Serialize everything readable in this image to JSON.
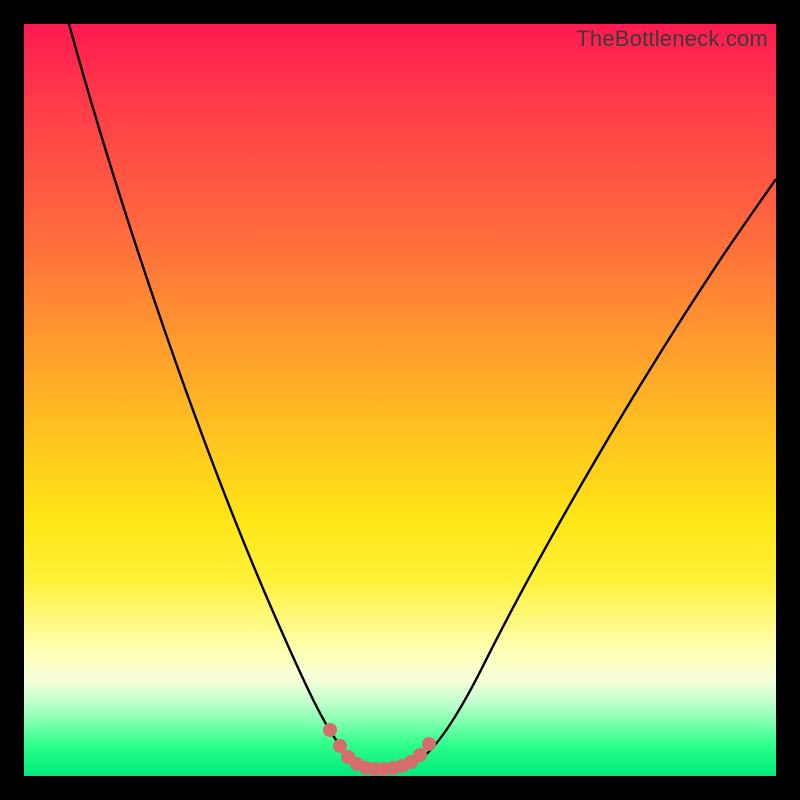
{
  "watermark": "TheBottleneck.com",
  "colors": {
    "frame": "#000000",
    "curve": "#000000",
    "dots": "#d66d6d"
  },
  "chart_data": {
    "type": "line",
    "title": "",
    "xlabel": "",
    "ylabel": "",
    "xlim": [
      0,
      100
    ],
    "ylim": [
      0,
      100
    ],
    "grid": false,
    "series": [
      {
        "name": "bottleneck-curve",
        "x": [
          6,
          10,
          15,
          20,
          25,
          30,
          35,
          38,
          40,
          42,
          44,
          46,
          48,
          50,
          52,
          54,
          58,
          65,
          75,
          85,
          95,
          100
        ],
        "y": [
          100,
          87,
          72,
          57,
          44,
          32,
          20,
          12,
          7,
          4,
          2,
          1,
          1,
          1,
          2,
          4,
          10,
          22,
          38,
          52,
          63,
          69
        ]
      }
    ],
    "markers": [
      {
        "name": "flat-region-dots",
        "x": [
          41,
          43,
          44,
          45,
          46,
          47,
          48,
          49,
          50,
          51,
          52,
          53
        ],
        "y": [
          6,
          3,
          2,
          1,
          1,
          1,
          1,
          1,
          1,
          2,
          3,
          5
        ]
      }
    ],
    "note": "Axis values estimated from pixel positions; chart has no visible tick labels or title."
  }
}
